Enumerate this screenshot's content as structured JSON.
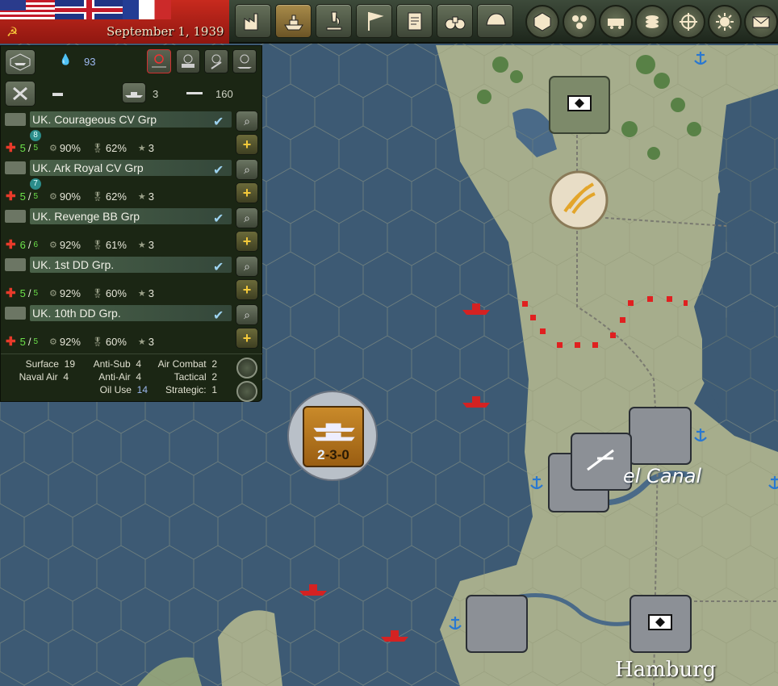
{
  "header": {
    "date": "September 1, 1939",
    "flags": [
      "us-flag",
      "uk-flag",
      "france-flag"
    ],
    "toolbar": [
      "production",
      "naval",
      "research",
      "diplomacy",
      "decisions",
      "intelligence",
      "army"
    ],
    "right_toolbar": [
      "hex-view",
      "hex-grid",
      "supply",
      "resources",
      "target",
      "weather",
      "messages"
    ]
  },
  "fleet_panel": {
    "oil": "93",
    "ships_count": "3",
    "range": "160",
    "units": [
      {
        "name": "UK. Courageous CV Grp",
        "badge": "8",
        "hp": "5",
        "hp_max": "5",
        "readiness": "90%",
        "morale": "62%",
        "exp": "3"
      },
      {
        "name": "UK. Ark Royal CV Grp",
        "badge": "7",
        "hp": "5",
        "hp_max": "5",
        "readiness": "90%",
        "morale": "62%",
        "exp": "3"
      },
      {
        "name": "UK. Revenge BB Grp",
        "badge": "",
        "hp": "6",
        "hp_max": "6",
        "readiness": "92%",
        "morale": "61%",
        "exp": "3"
      },
      {
        "name": "UK. 1st DD Grp.",
        "badge": "",
        "hp": "5",
        "hp_max": "5",
        "readiness": "92%",
        "morale": "60%",
        "exp": "3"
      },
      {
        "name": "UK. 10th DD Grp.",
        "badge": "",
        "hp": "5",
        "hp_max": "5",
        "readiness": "92%",
        "morale": "60%",
        "exp": "3"
      }
    ],
    "summary": {
      "surface_label": "Surface",
      "surface": "19",
      "naval_air_label": "Naval Air",
      "naval_air": "4",
      "anti_sub_label": "Anti-Sub",
      "anti_sub": "4",
      "anti_air_label": "Anti-Air",
      "anti_air": "4",
      "oil_use_label": "Oil Use",
      "oil_use": "14",
      "air_combat_label": "Air Combat",
      "air_combat": "2",
      "tactical_label": "Tactical",
      "tactical": "2",
      "strategic_label": "Strategic:",
      "strategic": "1"
    }
  },
  "map": {
    "canal_label": "el Canal",
    "city_label": "Hamburg",
    "selected_counter": {
      "a": "2",
      "b": "-3-0"
    }
  },
  "colors": {
    "sea": "#3d5a74",
    "land": "#a6ad8c",
    "panel": "#1b2614",
    "enemy_ship": "#d42222"
  }
}
